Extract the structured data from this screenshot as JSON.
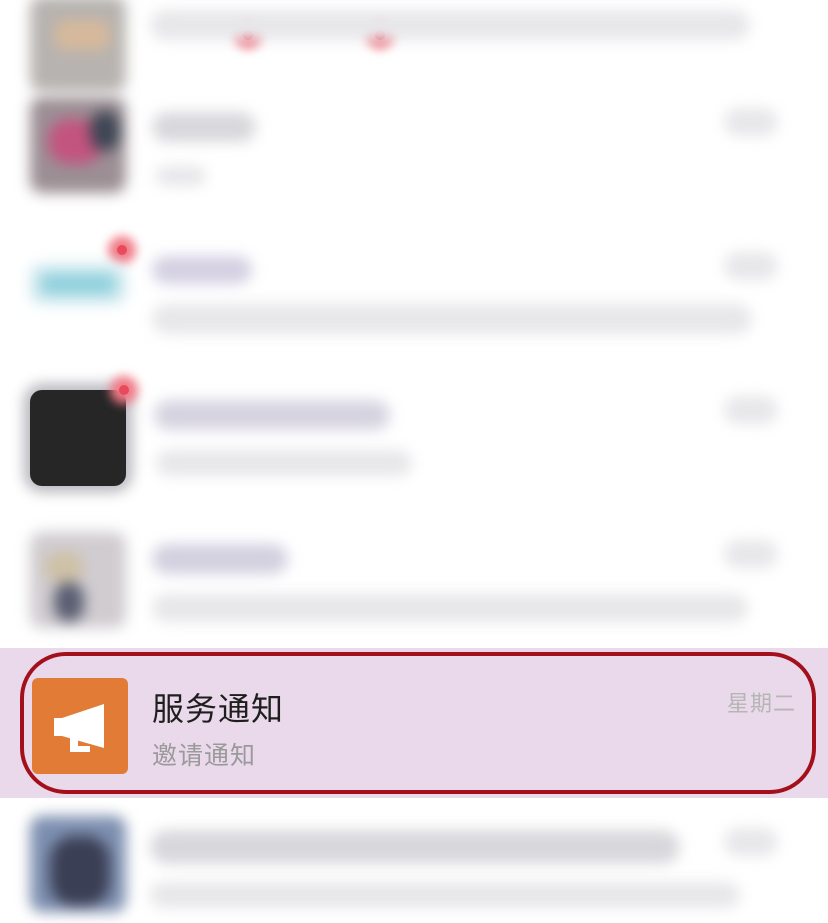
{
  "conversation_list": {
    "highlighted_item": {
      "title": "服务通知",
      "subtitle": "邀请通知",
      "time": "星期二",
      "icon": "megaphone-icon",
      "icon_bg_color": "#e27b35",
      "highlight_color": "#ead9ea",
      "outline_color": "#a3101c"
    }
  }
}
